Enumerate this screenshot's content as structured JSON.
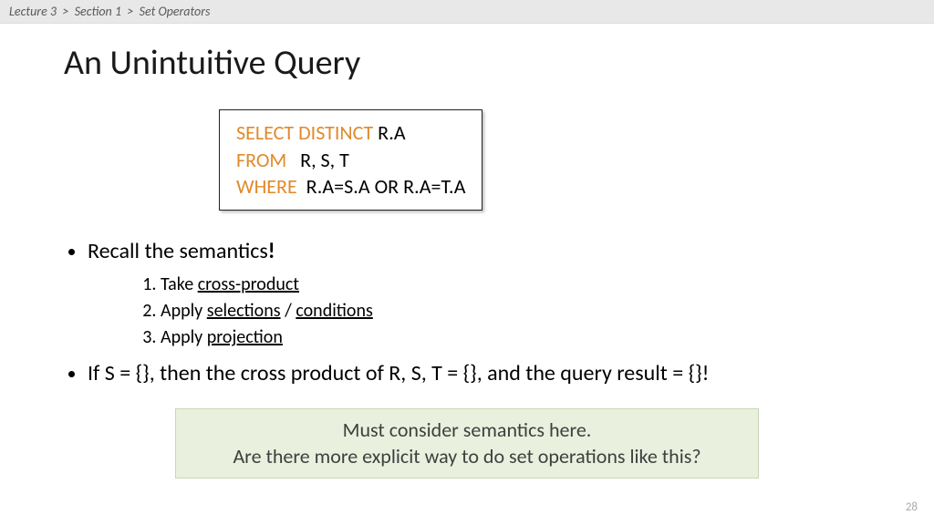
{
  "breadcrumb": {
    "lecture": "Lecture 3",
    "section": "Section 1",
    "topic": "Set Operators",
    "sep": ">"
  },
  "title": "An Unintuitive Query",
  "sql": {
    "kw_select": "SELECT DISTINCT",
    "select_rest": " R.A",
    "kw_from": "FROM",
    "from_rest": "   R, S, T",
    "kw_where": "WHERE",
    "where_rest": "  R.A=S.A OR R.A=T.A"
  },
  "bullets": {
    "b1_pre": "Recall the semantics",
    "b1_suf": "!",
    "steps": {
      "s1_pre": "Take ",
      "s1_u": "cross-product",
      "s2_pre": "Apply ",
      "s2_u1": "selections",
      "s2_mid": " / ",
      "s2_u2": "conditions",
      "s3_pre": "Apply ",
      "s3_u": "projection"
    },
    "b2": "If S = {}, then the cross product of R, S, T = {}, and the query result = {}!"
  },
  "callout": {
    "line1": "Must consider semantics here.",
    "line2": "Are there more explicit way to do set operations like this?"
  },
  "page_number": "28"
}
